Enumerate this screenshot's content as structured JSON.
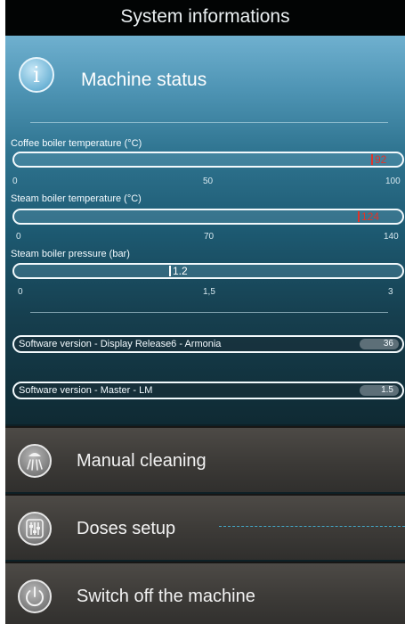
{
  "header": {
    "title": "System informations"
  },
  "status": {
    "title": "Machine status",
    "gauges": [
      {
        "label": "Coffee boiler temperature (°C)",
        "value": 92,
        "value_text": "92",
        "min": "0",
        "mid": "50",
        "max": "100",
        "range": [
          0,
          100
        ],
        "fraction": 0.92,
        "color": "#e0342a"
      },
      {
        "label": "Steam boiler temperature (°C)",
        "value": 124,
        "value_text": "124",
        "min": "0",
        "mid": "70",
        "max": "140",
        "range": [
          0,
          140
        ],
        "fraction": 0.886,
        "color": "#e0342a"
      },
      {
        "label": "Steam boiler pressure (bar)",
        "value": 1.2,
        "value_text": "1.2",
        "min": "0",
        "mid": "1,5",
        "max": "3",
        "range": [
          0,
          3
        ],
        "fraction": 0.4,
        "color": "#ffffff"
      }
    ],
    "software": [
      {
        "label": "Software version - Display Release6 - Armonia",
        "value": "36"
      },
      {
        "label": "Software version - Master - LM",
        "value": "1.5"
      }
    ]
  },
  "menu": {
    "items": [
      {
        "label": "Manual cleaning",
        "icon": "cleaning-shower-icon"
      },
      {
        "label": "Doses setup",
        "icon": "sliders-icon"
      },
      {
        "label": "Switch off the machine",
        "icon": "power-icon"
      }
    ]
  },
  "colors": {
    "accent": "#4e94b4",
    "alert": "#e0342a"
  }
}
